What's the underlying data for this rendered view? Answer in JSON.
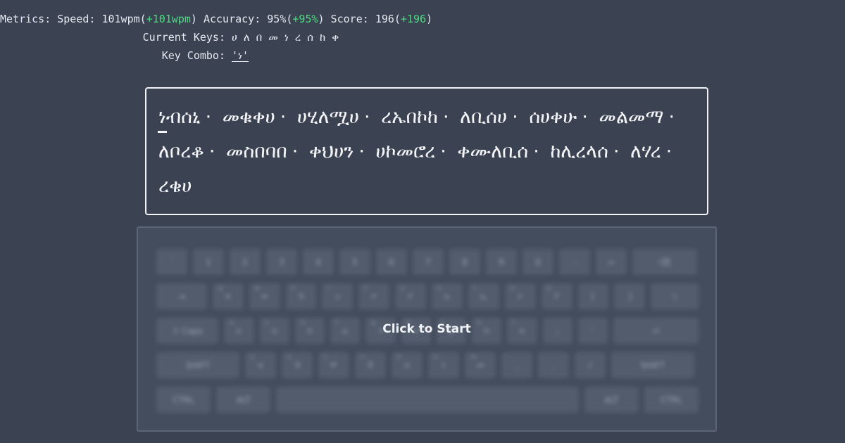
{
  "metrics": {
    "label": "Metrics:",
    "speed_label": "Speed:",
    "speed": "101wpm",
    "speed_delta": "+101wpm",
    "accuracy_label": "Accuracy:",
    "accuracy": "95%",
    "accuracy_delta": "+95%",
    "score_label": "Score:",
    "score": "196",
    "score_delta": "+196"
  },
  "current_keys": {
    "label": "Current Keys:",
    "keys": [
      "ሀ",
      "ለ",
      "በ",
      "መ",
      "ነ",
      "ረ",
      "ሰ",
      "ከ",
      "ቀ"
    ]
  },
  "key_combo": {
    "label": "Key Combo:",
    "value": "'ነ'"
  },
  "practice_text": {
    "words": [
      "ነብሰኒ",
      "መቁቀሀ",
      "ሀሂለሟሀ",
      "ረኤበኮከ",
      "ለቢሰሀ",
      "ሰሀቀሁ",
      "መልመማ",
      "ለቦረቆ",
      "መስበባበ",
      "ቀህሀን",
      "ሀኮመሮረ",
      "ቀሙለቢሰ",
      "ከሊረላሰ",
      "ለሃረ",
      "ረቄሀ"
    ],
    "separator": "·"
  },
  "keyboard": {
    "overlay_label": "Click to Start",
    "rows": [
      [
        {
          "l": "`"
        },
        {
          "l": "1"
        },
        {
          "l": "2"
        },
        {
          "l": "3"
        },
        {
          "l": "4"
        },
        {
          "l": "5"
        },
        {
          "l": "6"
        },
        {
          "l": "7"
        },
        {
          "l": "8"
        },
        {
          "l": "9"
        },
        {
          "l": "0"
        },
        {
          "l": "-"
        },
        {
          "l": "="
        },
        {
          "l": "⌫"
        }
      ],
      [
        {
          "l": "⇥"
        },
        {
          "l": "ቀ",
          "s": "q"
        },
        {
          "l": "ወ",
          "s": "w"
        },
        {
          "l": "ኧ",
          "s": "e"
        },
        {
          "l": "ረ",
          "s": "r"
        },
        {
          "l": "ተ",
          "s": "t"
        },
        {
          "l": "የ",
          "s": "y"
        },
        {
          "l": "ኡ",
          "s": "u"
        },
        {
          "l": "ኢ",
          "s": "i"
        },
        {
          "l": "ኦ",
          "s": "o"
        },
        {
          "l": "ፐ",
          "s": "p"
        },
        {
          "l": "["
        },
        {
          "l": "]"
        },
        {
          "l": "\\"
        }
      ],
      [
        {
          "l": "⇪ Caps"
        },
        {
          "l": "አ",
          "s": "a"
        },
        {
          "l": "ሰ",
          "s": "s"
        },
        {
          "l": "ደ",
          "s": "d"
        },
        {
          "l": "ፈ",
          "s": "f"
        },
        {
          "l": "ገ",
          "s": "g"
        },
        {
          "l": "ሀ",
          "s": "h"
        },
        {
          "l": "ጀ",
          "s": "j"
        },
        {
          "l": "ከ",
          "s": "k"
        },
        {
          "l": "ለ",
          "s": "l"
        },
        {
          "l": ";"
        },
        {
          "l": "'"
        },
        {
          "l": "⏎"
        }
      ],
      [
        {
          "l": "SHIFT"
        },
        {
          "l": "ዘ",
          "s": "z"
        },
        {
          "l": "ኸ",
          "s": "x"
        },
        {
          "l": "ቸ",
          "s": "c"
        },
        {
          "l": "ቨ",
          "s": "v"
        },
        {
          "l": "በ",
          "s": "b"
        },
        {
          "l": "ነ",
          "s": "n"
        },
        {
          "l": "መ",
          "s": "m"
        },
        {
          "l": ","
        },
        {
          "l": "."
        },
        {
          "l": "/"
        },
        {
          "l": "SHIFT"
        }
      ],
      [
        {
          "l": "CTRL"
        },
        {
          "l": "ALT"
        },
        {
          "l": ""
        },
        {
          "l": "ALT"
        },
        {
          "l": "CTRL"
        }
      ]
    ]
  }
}
